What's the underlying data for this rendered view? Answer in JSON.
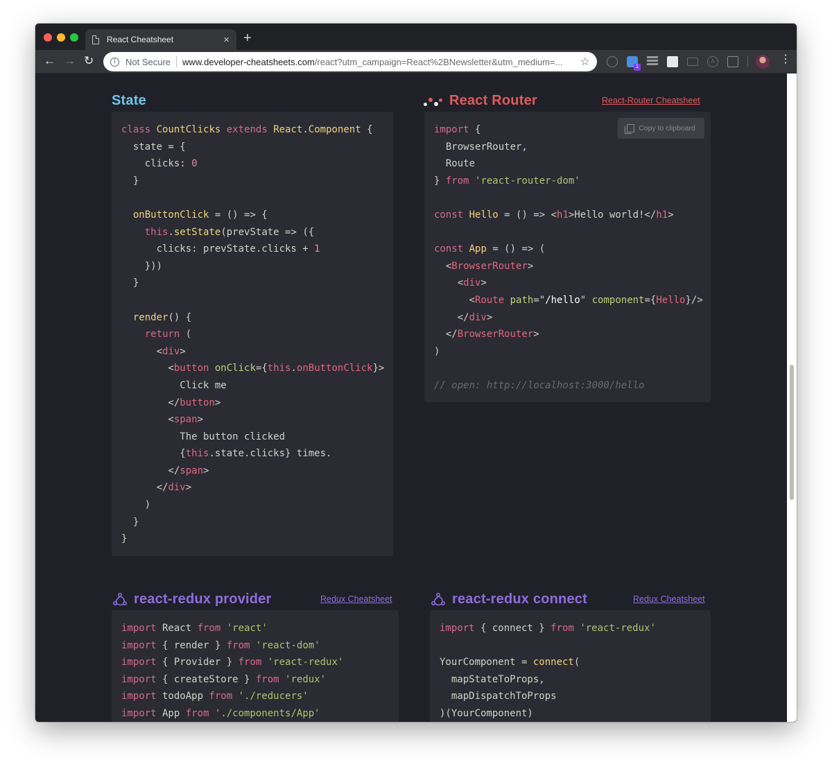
{
  "browser": {
    "tab_title": "React Cheatsheet",
    "tab_close": "×",
    "new_tab": "+",
    "back": "←",
    "forward": "→",
    "reload": "↻",
    "security_label": "Not Secure",
    "url_host": "www.developer-cheatsheets.com",
    "url_path": "/react?utm_campaign=React%2BNewsletter&utm_medium=...",
    "extension_badge": "1",
    "menu": "⋮",
    "star": "☆"
  },
  "sections": {
    "state": {
      "title": "State"
    },
    "router": {
      "title": "React Router",
      "link": "React-Router Cheatsheet",
      "copy_button": "Copy to clipboard"
    },
    "provider": {
      "title": "react-redux provider",
      "link": "Redux Cheatsheet"
    },
    "connect": {
      "title": "react-redux connect",
      "link": "Redux Cheatsheet"
    }
  },
  "colors": {
    "page_bg": "#1f2028",
    "code_bg": "#2a2b33",
    "state_title": "#6ec6e8",
    "router_title": "#e15a5a",
    "redux_title": "#8c6ee0",
    "keyword": "#d66a8f",
    "string": "#b5c26b"
  }
}
